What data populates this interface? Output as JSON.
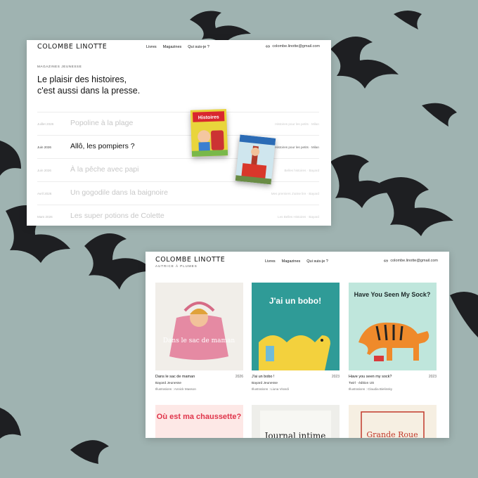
{
  "window1": {
    "logo": "Colombe Linotte",
    "nav": [
      "Livres",
      "Magazines",
      "Qui suis-je ?"
    ],
    "email": "colombe.linotte@gmail.com",
    "eyebrow": "MAGAZINES JEUNESSE",
    "headline_line1": "Le plaisir des histoires,",
    "headline_line2": "c'est aussi dans la presse.",
    "magazine_cover_title": "Histoires",
    "items": [
      {
        "date": "Juillet 2026",
        "title": "Popoline à la plage",
        "meta": "Histoires pour les petits · Milan",
        "active": false
      },
      {
        "date": "Juin 2026",
        "title": "Allô, les pompiers ?",
        "meta": "Histoires pour les petits · Milan",
        "active": true
      },
      {
        "date": "Juin 2026",
        "title": "À la pêche avec papi",
        "meta": "Belles histoires · Bayard",
        "active": false
      },
      {
        "date": "Avril 2026",
        "title": "Un gogodile dans la baignoire",
        "meta": "Mes premiers J'aime lire · Bayard",
        "active": false
      },
      {
        "date": "Mars 2026",
        "title": "Les super potions de Colette",
        "meta": "Les Belles Histoires · Bayard",
        "active": false
      }
    ]
  },
  "window2": {
    "logo": "Colombe Linotte",
    "tagline": "AUTRICE À PLUMES",
    "nav": [
      "Livres",
      "Magazines",
      "Qui suis-je ?"
    ],
    "email": "colombe.linotte@gmail.com",
    "books": [
      {
        "title": "Dans le sac de maman",
        "year": "2026",
        "publisher": "Bayard Jeunesse",
        "illustrator": "Illustrations : Annick Masson",
        "cover_text": "Dans le sac de maman",
        "cover_color": "#f1eee9"
      },
      {
        "title": "J'ai un bobo !",
        "year": "2023",
        "publisher": "Bayard Jeunesse",
        "illustrator": "Illustrations : Liuna Virardi",
        "cover_text": "J'ai un bobo!",
        "cover_color": "#2f9b97"
      },
      {
        "title": "Have you seen my sock?",
        "year": "2023",
        "publisher": "Twirl · édition US",
        "illustrator": "Illustrations : Claudia Bielinsky",
        "cover_text": "Have You Seen My Sock?",
        "cover_color": "#bfe6dc"
      },
      {
        "title": "",
        "year": "",
        "publisher": "",
        "illustrator": "",
        "cover_text": "Où est ma chaussette?",
        "cover_color": "#fde8e6"
      },
      {
        "title": "",
        "year": "",
        "publisher": "",
        "illustrator": "",
        "cover_text": "Journal intime",
        "cover_color": "#eeeeea"
      },
      {
        "title": "",
        "year": "",
        "publisher": "",
        "illustrator": "",
        "cover_text": "Grande Roue",
        "cover_color": "#f6efe2"
      }
    ]
  },
  "colors": {
    "background": "#9fb3b1",
    "bird": "#1e1f22"
  }
}
